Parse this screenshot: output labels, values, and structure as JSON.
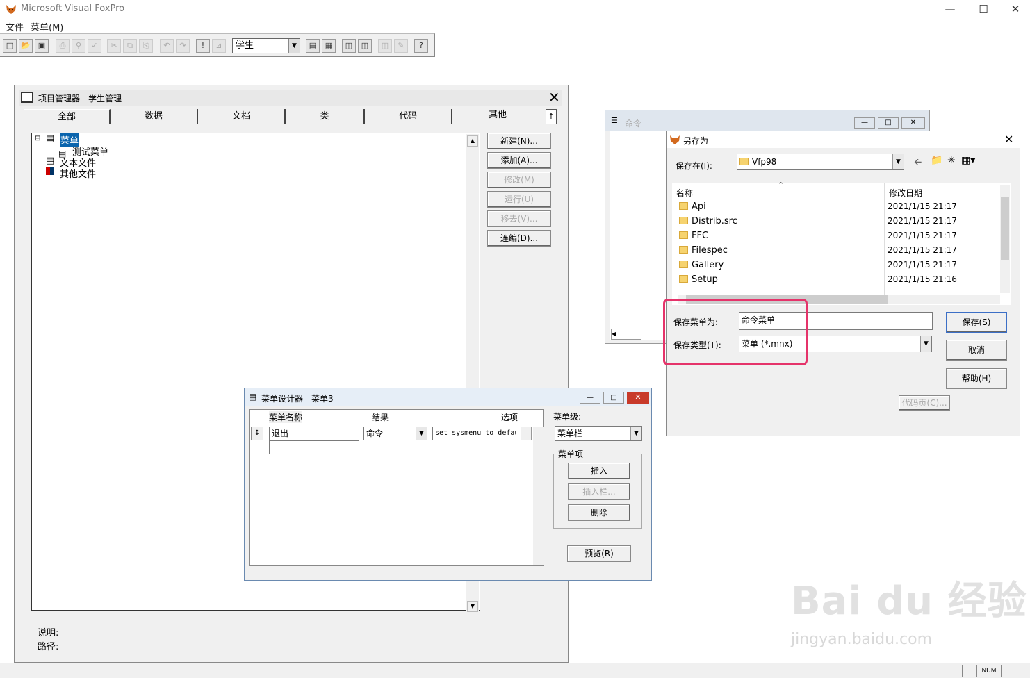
{
  "app": {
    "title": "Microsoft Visual FoxPro"
  },
  "menubar": {
    "items": [
      "文件",
      "菜单(M)"
    ]
  },
  "toolbar": {
    "combo_value": "学生"
  },
  "project_manager": {
    "title": "项目管理器 - 学生管理",
    "tabs": [
      "全部",
      "数据",
      "文档",
      "类",
      "代码",
      "其他"
    ],
    "tree": {
      "root": "菜单",
      "child": "测试菜单",
      "items": [
        "文本文件",
        "其他文件"
      ]
    },
    "buttons": [
      "新建(N)...",
      "添加(A)...",
      "修改(M)",
      "运行(U)",
      "移去(V)...",
      "连编(D)..."
    ],
    "desc_label": "说明:",
    "path_label": "路径:"
  },
  "menu_designer": {
    "title": "菜单设计器 - 菜单3",
    "col_name": "菜单名称",
    "col_result": "结果",
    "col_options": "选项",
    "row_name": "退出",
    "row_result": "命令",
    "row_command": "set sysmenu to default",
    "level_label": "菜单级:",
    "level_value": "菜单栏",
    "group_label": "菜单项",
    "btn_insert": "插入",
    "btn_insert_bar": "插入栏...",
    "btn_delete": "删除",
    "btn_preview": "预览(R)"
  },
  "command_window": {
    "title": "命令"
  },
  "save_as": {
    "title": "另存为",
    "save_in_label": "保存在(I):",
    "save_in_value": "Vfp98",
    "col_name": "名称",
    "col_date": "修改日期",
    "files": [
      {
        "name": "Api",
        "date": "2021/1/15 21:17"
      },
      {
        "name": "Distrib.src",
        "date": "2021/1/15 21:17"
      },
      {
        "name": "FFC",
        "date": "2021/1/15 21:17"
      },
      {
        "name": "Filespec",
        "date": "2021/1/15 21:17"
      },
      {
        "name": "Gallery",
        "date": "2021/1/15 21:17"
      },
      {
        "name": "Setup",
        "date": "2021/1/15 21:16"
      }
    ],
    "filename_label": "保存菜单为:",
    "filename_value": "命令菜单",
    "filetype_label": "保存类型(T):",
    "filetype_value": "菜单 (*.mnx)",
    "btn_save": "保存(S)",
    "btn_cancel": "取消",
    "btn_help": "帮助(H)",
    "btn_codepage": "代码页(C)..."
  },
  "statusbar": {
    "num": "NUM"
  },
  "watermark": {
    "brand": "Bai du 经验",
    "url": "jingyan.baidu.com"
  },
  "colors": {
    "highlight": "#e5336a",
    "folder": "#f6d36f"
  }
}
